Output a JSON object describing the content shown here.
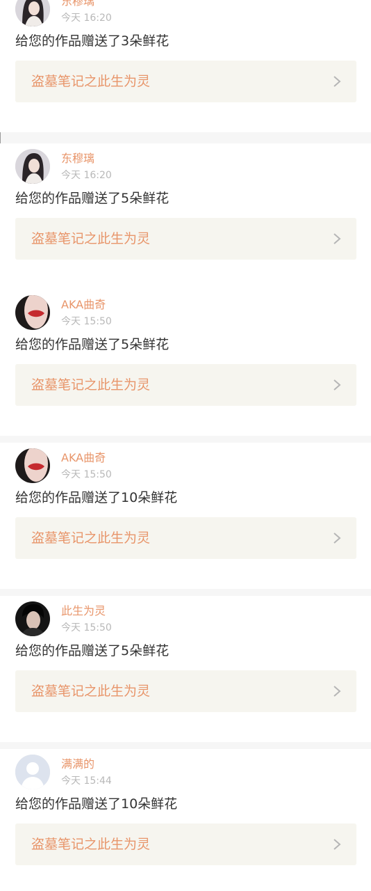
{
  "notifications": [
    {
      "user": "东穆璃",
      "time": "今天 16:20",
      "message": "给您的作品赠送了3朵鲜花",
      "work_title": "盗墓笔记之此生为灵",
      "avatar": "woman-portrait-avatar"
    },
    {
      "user": "东穆璃",
      "time": "今天 16:20",
      "message": "给您的作品赠送了5朵鲜花",
      "work_title": "盗墓笔记之此生为灵",
      "avatar": "woman-portrait-avatar"
    },
    {
      "user": "AKA曲奇",
      "time": "今天 15:50",
      "message": "给您的作品赠送了5朵鲜花",
      "work_title": "盗墓笔记之此生为灵",
      "avatar": "red-lips-avatar"
    },
    {
      "user": "AKA曲奇",
      "time": "今天 15:50",
      "message": "给您的作品赠送了10朵鲜花",
      "work_title": "盗墓笔记之此生为灵",
      "avatar": "red-lips-avatar"
    },
    {
      "user": "此生为灵",
      "time": "今天 15:50",
      "message": "给您的作品赠送了5朵鲜花",
      "work_title": "盗墓笔记之此生为灵",
      "avatar": "man-portrait-avatar"
    },
    {
      "user": "满满的",
      "time": "今天 15:44",
      "message": "给您的作品赠送了10朵鲜花",
      "work_title": "盗墓笔记之此生为灵",
      "avatar": "default-user-avatar"
    }
  ],
  "colors": {
    "accent": "#e8956a",
    "time": "#b8b8b8",
    "text": "#333333",
    "link_bg": "#f6f5ef",
    "separator": "#f6f6f6"
  }
}
